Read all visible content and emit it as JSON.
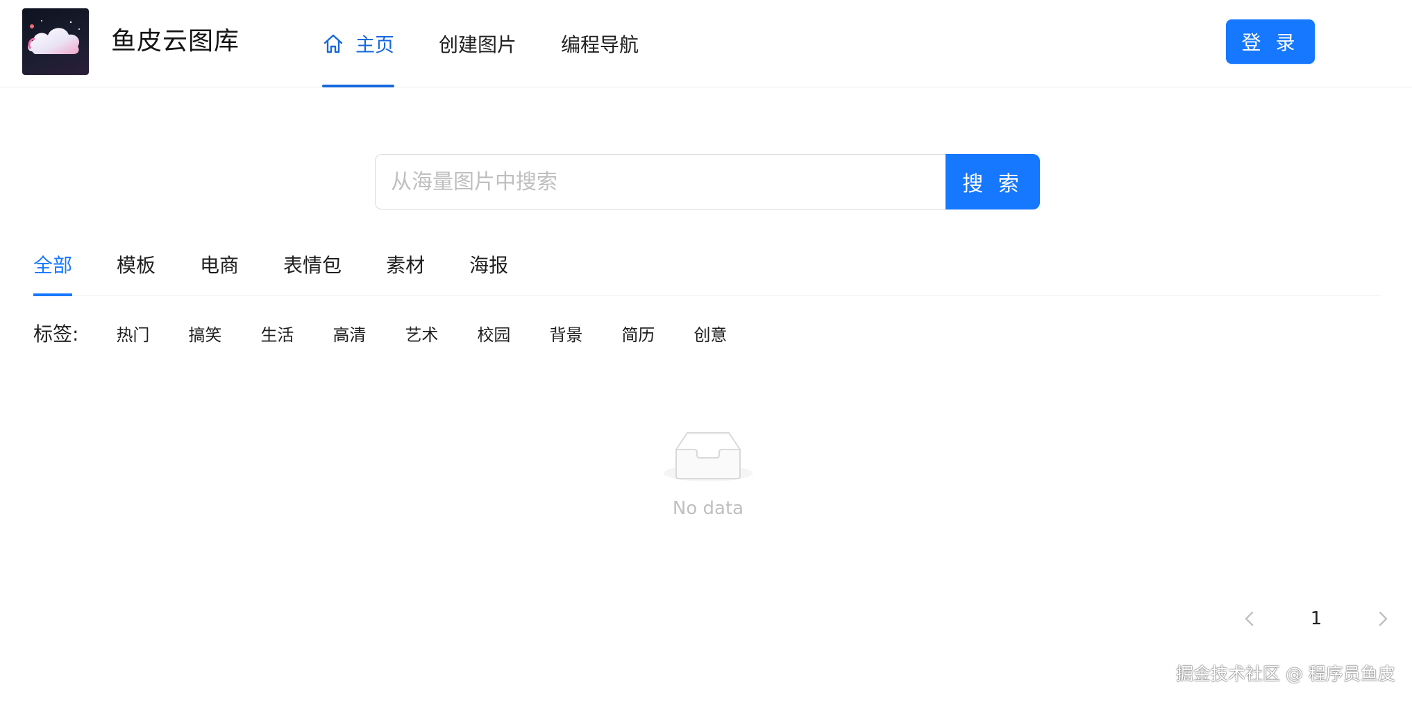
{
  "header": {
    "brand": "鱼皮云图库",
    "nav": [
      {
        "label": "主页",
        "icon": "home-icon",
        "active": true
      },
      {
        "label": "创建图片",
        "active": false
      },
      {
        "label": "编程导航",
        "active": false
      }
    ],
    "login_label": "登 录"
  },
  "search": {
    "placeholder": "从海量图片中搜索",
    "value": "",
    "button_label": "搜 索"
  },
  "categories": [
    {
      "label": "全部",
      "active": true
    },
    {
      "label": "模板"
    },
    {
      "label": "电商"
    },
    {
      "label": "表情包"
    },
    {
      "label": "素材"
    },
    {
      "label": "海报"
    }
  ],
  "tags": {
    "label": "标签:",
    "items": [
      "热门",
      "搞笑",
      "生活",
      "高清",
      "艺术",
      "校园",
      "背景",
      "简历",
      "创意"
    ]
  },
  "empty_state": {
    "icon": "empty-inbox-icon",
    "text": "No data"
  },
  "pagination": {
    "current_page": "1",
    "prev_icon": "chevron-left-icon",
    "next_icon": "chevron-right-icon"
  },
  "watermark": "掘金技术社区 @ 程序员鱼皮",
  "colors": {
    "primary": "#1677ff",
    "active_nav": "#1668dc",
    "muted": "#bfbfbf"
  }
}
